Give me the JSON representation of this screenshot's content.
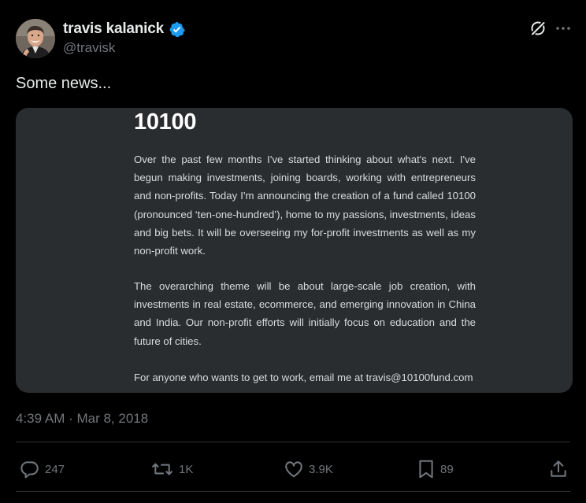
{
  "author": {
    "display_name": "travis kalanick",
    "handle": "@travisk",
    "verified": true
  },
  "tweet": {
    "text": "Some news...",
    "timestamp": "4:39 AM · Mar 8, 2018"
  },
  "media": {
    "title": "10100",
    "paragraphs": [
      "Over the past few months I've started thinking about what's next. I've begun making investments, joining boards, working with entrepreneurs and non-profits. Today I'm announcing the creation of a fund called 10100 (pronounced ‘ten-one-hundred’), home to my passions, investments, ideas and big bets. It will be overseeing my for-profit investments as well as my non-profit work.",
      "The overarching theme will be about large-scale job creation, with investments in real estate, ecommerce, and emerging innovation in China and India. Our non-profit efforts will initially focus on education and the future of cities.",
      "For anyone who wants to get to work, email me at travis@10100fund.com"
    ]
  },
  "actions": {
    "replies": "247",
    "reposts": "1K",
    "likes": "3.9K",
    "bookmarks": "89"
  },
  "icons": {
    "verified": "verified-badge-icon",
    "grok": "grok-icon",
    "more": "more-icon",
    "reply": "reply-icon",
    "repost": "repost-icon",
    "like": "heart-icon",
    "bookmark": "bookmark-icon",
    "share": "share-icon"
  },
  "colors": {
    "background": "#000000",
    "text": "#e7e9ea",
    "muted": "#71767b",
    "verified": "#1d9bf0",
    "card": "#2a2d30"
  }
}
